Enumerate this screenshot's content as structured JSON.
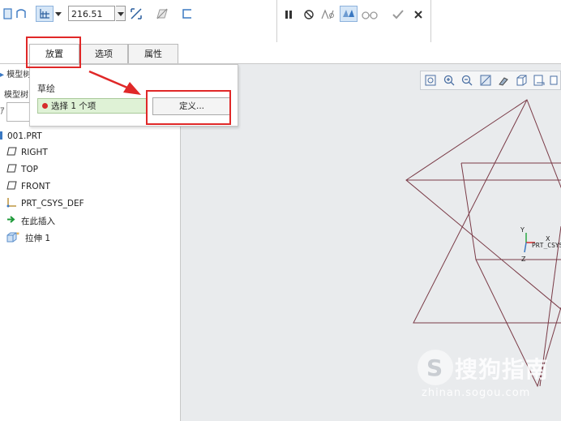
{
  "toolbar": {
    "depth_value": "216.51",
    "icons": [
      "extrude-solid-icon",
      "extrude-surface-icon",
      "depth-option-icon",
      "flip-direction-icon",
      "remove-material-icon",
      "thicken-icon",
      "pause-icon",
      "no-preview-icon",
      "verify-icon",
      "preview-icon",
      "glasses-icon",
      "ok-check-icon",
      "cancel-x-icon"
    ]
  },
  "tabs": [
    {
      "label": "放置",
      "active": true
    },
    {
      "label": "选项",
      "active": false
    },
    {
      "label": "属性",
      "active": false
    }
  ],
  "placement_panel": {
    "section_label": "草绘",
    "collector_text": "选择 1 个项",
    "define_button": "定义..."
  },
  "model_tree": {
    "header_fragment": "模型树",
    "header_fragment2": "模型树",
    "items": [
      {
        "label": "001.PRT",
        "icon": "part-icon"
      },
      {
        "label": "RIGHT",
        "icon": "datum-plane-icon"
      },
      {
        "label": "TOP",
        "icon": "datum-plane-icon"
      },
      {
        "label": "FRONT",
        "icon": "datum-plane-icon"
      },
      {
        "label": "PRT_CSYS_DEF",
        "icon": "coordinate-system-icon"
      },
      {
        "label": "在此插入",
        "icon": "insert-here-arrow-icon"
      },
      {
        "label": "拉伸 1",
        "icon": "extrude-feature-icon"
      }
    ]
  },
  "graphics": {
    "csys_label": "PRT_CSYS",
    "axis_x": "X",
    "axis_y": "Y",
    "axis_z": "Z"
  },
  "watermark": {
    "brand": "搜狗指南",
    "url": "zhinan.sogou.com"
  },
  "colors": {
    "sketch_line": "#7a3b47",
    "annotation_red": "#e02828",
    "status_green_bg": "#dff2d6",
    "status_dot": "#d62b2b"
  }
}
